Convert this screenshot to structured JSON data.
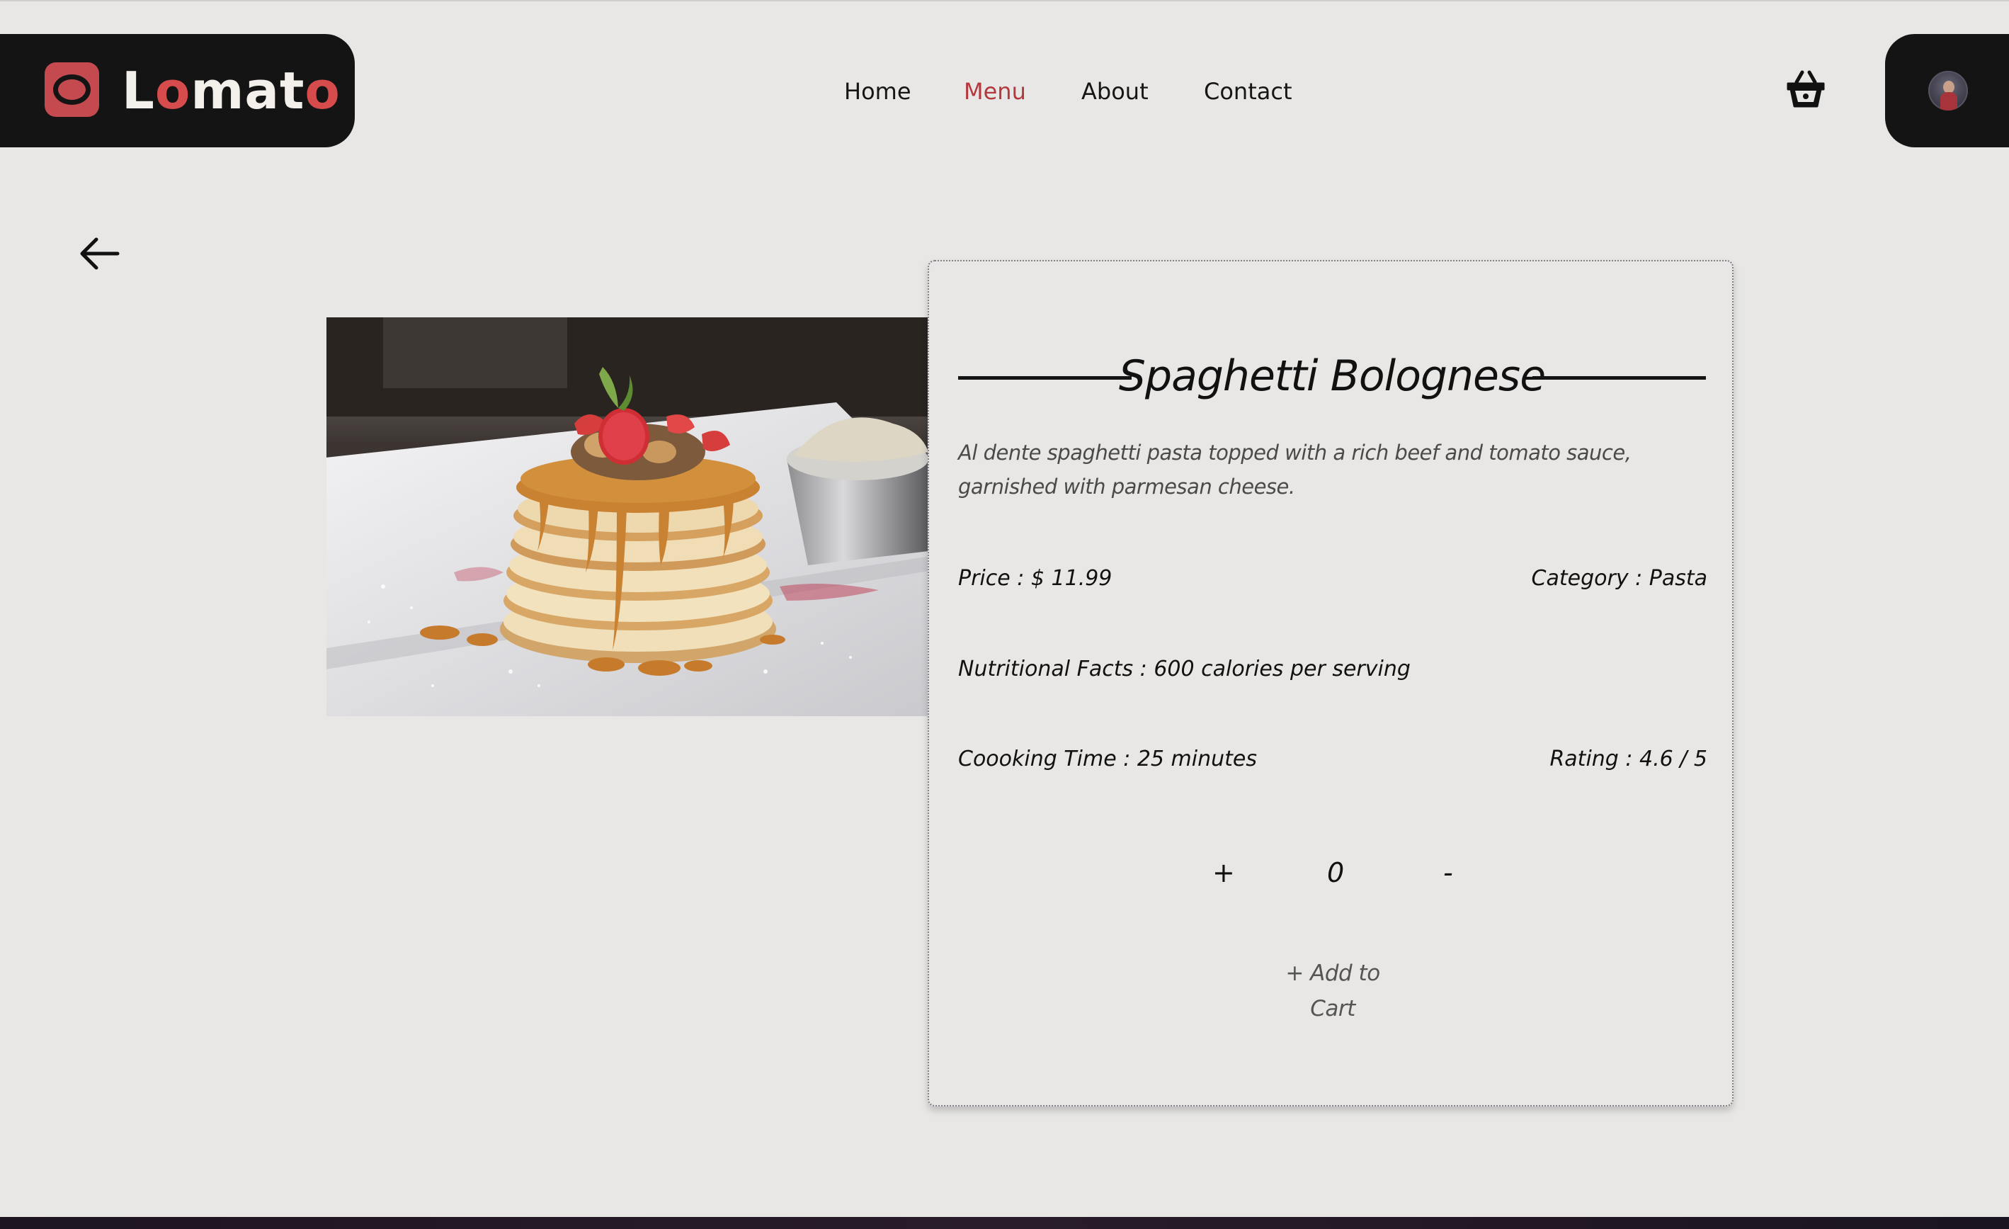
{
  "brand": {
    "name_parts": [
      {
        "text": "L",
        "accent": false
      },
      {
        "text": "o",
        "accent": true
      },
      {
        "text": "mat",
        "accent": false
      },
      {
        "text": "o",
        "accent": true
      }
    ],
    "accent_color": "#d64c4c"
  },
  "nav": {
    "items": [
      {
        "label": "Home",
        "active": false
      },
      {
        "label": "Menu",
        "active": true
      },
      {
        "label": "About",
        "active": false
      },
      {
        "label": "Contact",
        "active": false
      }
    ],
    "active_color": "#b4393e"
  },
  "header": {
    "cart_icon": "basket-icon",
    "avatar_icon": "user-avatar"
  },
  "back": {
    "icon": "arrow-left-icon"
  },
  "dish": {
    "image_icon": "pancake-stack-photo",
    "title": "Spaghetti Bolognese",
    "description": "Al dente spaghetti pasta topped with a rich beef and tomato sauce, garnished with parmesan cheese.",
    "price": "Price : $ 11.99",
    "category": "Category : Pasta",
    "nutrition": "Nutritional Facts : 600 calories per serving",
    "cooking_time": "Coooking Time : 25 minutes",
    "rating": "Rating : 4.6 / 5"
  },
  "quantity": {
    "increment_label": "+",
    "value": "0",
    "decrement_label": "-"
  },
  "actions": {
    "add_to_cart": "+ Add to Cart"
  }
}
